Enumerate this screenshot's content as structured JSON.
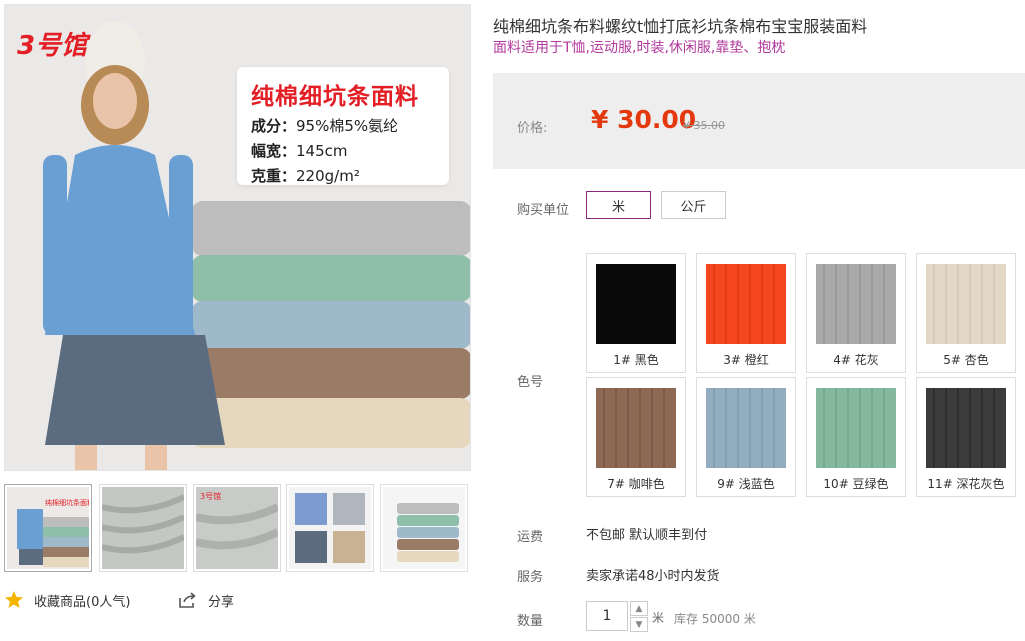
{
  "gallery": {
    "logo_text": "3号馆",
    "promo_title": "纯棉细坑条面料",
    "promo_lines": [
      {
        "label": "成分：",
        "value": "95%棉5%氨纶"
      },
      {
        "label": "幅宽：",
        "value": "145cm"
      },
      {
        "label": "克重：",
        "value": "220g/m²"
      }
    ],
    "thumbnails": [
      "thumb-1",
      "thumb-2",
      "thumb-3",
      "thumb-4",
      "thumb-5"
    ],
    "favorite_label": "收藏商品(0人气)",
    "share_label": "分享"
  },
  "product": {
    "title": "纯棉细坑条布料螺纹t恤打底衫坑条棉布宝宝服装面料",
    "subtitle": "面料适用于T恤,运动服,时装,休闲服,靠垫、抱枕"
  },
  "price": {
    "label": "价格:",
    "current": "¥ 30.00",
    "original": "¥ 35.00"
  },
  "unit": {
    "label": "购买单位",
    "options": [
      "米",
      "公斤"
    ],
    "selected": "米"
  },
  "color": {
    "label": "色号",
    "swatches": [
      {
        "name": "1# 黑色",
        "color": "#0a0a0a"
      },
      {
        "name": "3# 橙红",
        "color": "#f4471f"
      },
      {
        "name": "4# 花灰",
        "color": "#a9a9a9"
      },
      {
        "name": "5# 杏色",
        "color": "#e3d8c6"
      },
      {
        "name": "7# 咖啡色",
        "color": "#8e6a55"
      },
      {
        "name": "9# 浅蓝色",
        "color": "#93adc0"
      },
      {
        "name": "10# 豆绿色",
        "color": "#85b89c"
      },
      {
        "name": "11# 深花灰色",
        "color": "#3b3b3b"
      }
    ]
  },
  "shipping": {
    "label": "运费",
    "value": "不包邮 默认顺丰到付"
  },
  "service": {
    "label": "服务",
    "value": "卖家承诺48小时内发货"
  },
  "quantity": {
    "label": "数量",
    "value": "1",
    "unit": "米",
    "stock": "库存 50000 米"
  },
  "colors": {
    "accent_price": "#e4390e",
    "accent_purple": "#b23a9d",
    "selected_border": "#8a2a78",
    "price_bg": "#eeeeee"
  }
}
